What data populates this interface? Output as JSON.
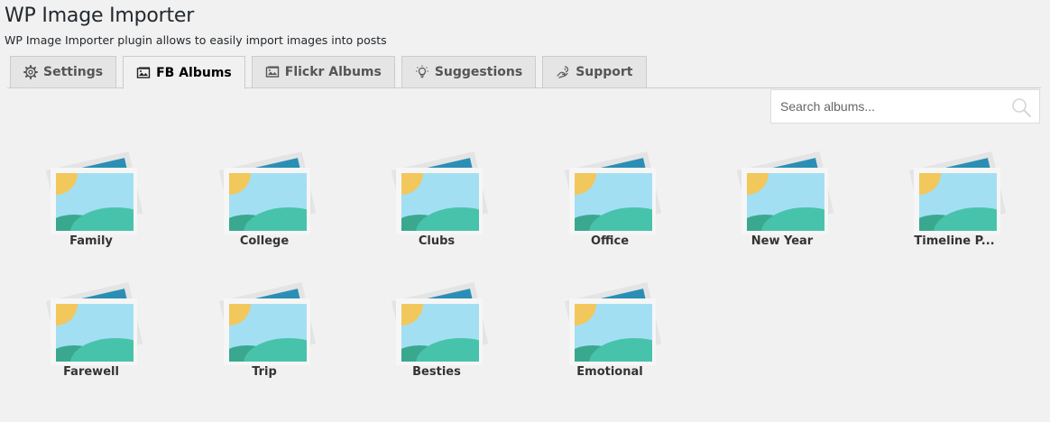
{
  "header": {
    "title": "WP Image Importer",
    "subtitle": "WP Image Importer plugin allows to easily import images into posts"
  },
  "tabs": [
    {
      "label": "Settings",
      "icon": "gear-icon",
      "active": false
    },
    {
      "label": "FB Albums",
      "icon": "image-icon",
      "active": true
    },
    {
      "label": "Flickr Albums",
      "icon": "image-icon",
      "active": false
    },
    {
      "label": "Suggestions",
      "icon": "lightbulb-icon",
      "active": false
    },
    {
      "label": "Support",
      "icon": "support-hand-icon",
      "active": false
    }
  ],
  "search": {
    "placeholder": "Search albums...",
    "value": ""
  },
  "albums": [
    {
      "name": "Family"
    },
    {
      "name": "College"
    },
    {
      "name": "Clubs"
    },
    {
      "name": "Office"
    },
    {
      "name": "New Year"
    },
    {
      "name": "Timeline P..."
    },
    {
      "name": "Farewell"
    },
    {
      "name": "Trip"
    },
    {
      "name": "Besties"
    },
    {
      "name": "Emotional"
    }
  ],
  "colors": {
    "photo_back": "#2b8fb5",
    "photo_sky": "#a3dff3",
    "photo_sun": "#f2c75c",
    "photo_hill_front": "#48c3ab",
    "photo_hill_back": "#3aa88f",
    "photo_frame": "#f6f6f6"
  }
}
